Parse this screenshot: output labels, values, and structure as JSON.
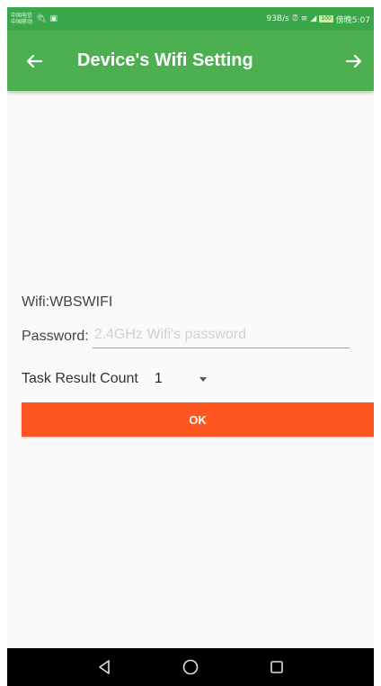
{
  "status_bar": {
    "carrier_line1": "中国电信",
    "carrier_line2": "中国移动",
    "speed": "93B/s",
    "battery": "100",
    "time": "傍晚5:07"
  },
  "app_bar": {
    "title": "Device's Wifi Setting",
    "back_icon": "arrow-left-icon",
    "forward_icon": "arrow-right-icon"
  },
  "form": {
    "wifi_label": "Wifi:WBSWIFI",
    "password_label": "Password:",
    "password_value": "",
    "password_placeholder": "2.4GHz Wifi's password",
    "task_label": "Task Result Count",
    "task_selected": "1",
    "ok_label": "OK"
  },
  "colors": {
    "status_bar": "#3aa84a",
    "app_bar": "#4caf50",
    "ok_button": "#ff5722",
    "nav_bar": "#000000"
  },
  "nav_bar": {
    "back_icon": "nav-back-icon",
    "home_icon": "nav-home-icon",
    "recents_icon": "nav-recents-icon"
  }
}
